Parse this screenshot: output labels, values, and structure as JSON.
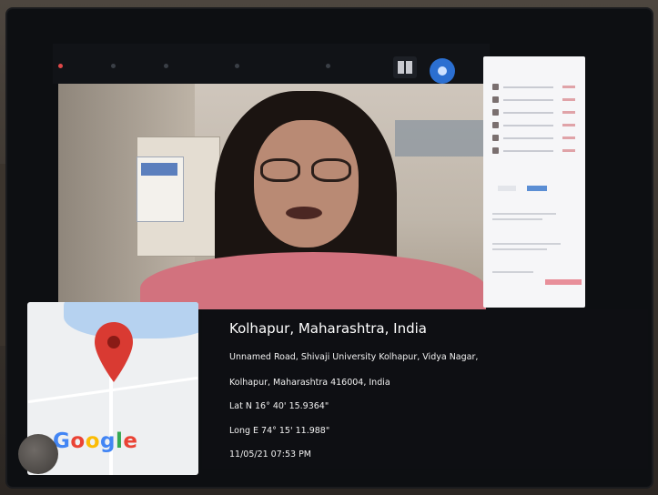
{
  "location": {
    "title": "Kolhapur, Maharashtra, India",
    "address_line1": "Unnamed Road, Shivaji University Kolhapur, Vidya Nagar,",
    "address_line2": "Kolhapur, Maharashtra 416004, India",
    "latitude": "Lat N 16° 40' 15.9364\"",
    "longitude": "Long E 74° 15' 11.988\"",
    "datetime": "11/05/21 07:53 PM"
  },
  "map": {
    "logo_text": [
      "G",
      "o",
      "o",
      "g",
      "l",
      "e"
    ],
    "pin_color": "#d93a32"
  },
  "colors": {
    "overlay_bg": "#0e0f13",
    "accent_blue": "#2b6fd1",
    "panel_pink": "#e88f9a"
  }
}
